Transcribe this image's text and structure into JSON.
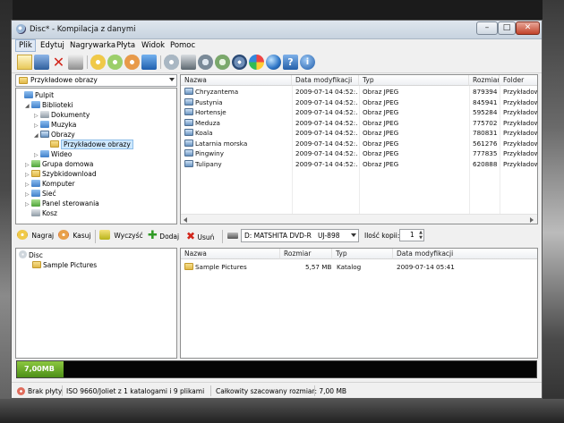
{
  "window": {
    "title": "Disc* - Kompilacja z danymi"
  },
  "title_buttons": {
    "minimize": "–",
    "maximize": "□",
    "close": "✕"
  },
  "menu": [
    "Plik",
    "Edytuj",
    "Nagrywarka",
    "Płyta",
    "Widok",
    "Pomoc"
  ],
  "toolbar_icons": [
    "new-document-icon",
    "save-icon",
    "delete-icon",
    "print-icon",
    "add-files-icon",
    "add-folder-icon",
    "disc-icon",
    "burn-icon",
    "copy-disc-icon",
    "erase-icon",
    "audio-icon",
    "settings-icon",
    "media-icon",
    "globe-icon",
    "help-icon",
    "info-icon"
  ],
  "folder_tree": {
    "combo_value": "Przykładowe obrazy",
    "items": [
      {
        "label": "Pulpit",
        "icon": "desktop-icon",
        "level": 0,
        "toggle": ""
      },
      {
        "label": "Biblioteki",
        "icon": "libraries-icon",
        "level": 1,
        "toggle": "◢"
      },
      {
        "label": "Dokumenty",
        "icon": "documents-icon",
        "level": 2,
        "toggle": "▷"
      },
      {
        "label": "Muzyka",
        "icon": "music-icon",
        "level": 2,
        "toggle": "▷"
      },
      {
        "label": "Obrazy",
        "icon": "pictures-icon",
        "level": 2,
        "toggle": "◢"
      },
      {
        "label": "Przykładowe obrazy",
        "icon": "folder-icon",
        "level": 3,
        "toggle": "",
        "selected": true
      },
      {
        "label": "Wideo",
        "icon": "video-icon",
        "level": 2,
        "toggle": "▷"
      },
      {
        "label": "Grupa domowa",
        "icon": "homegroup-icon",
        "level": 1,
        "toggle": "▷"
      },
      {
        "label": "Szybkidownload",
        "icon": "user-folder-icon",
        "level": 1,
        "toggle": "▷"
      },
      {
        "label": "Komputer",
        "icon": "computer-icon",
        "level": 1,
        "toggle": "▷"
      },
      {
        "label": "Sieć",
        "icon": "network-icon",
        "level": 1,
        "toggle": "▷"
      },
      {
        "label": "Panel sterowania",
        "icon": "control-panel-icon",
        "level": 1,
        "toggle": "▷"
      },
      {
        "label": "Kosz",
        "icon": "recycle-bin-icon",
        "level": 1,
        "toggle": ""
      }
    ]
  },
  "file_list": {
    "columns": [
      "Nazwa",
      "Data modyfikacji",
      "Typ",
      "Rozmiar",
      "Folder"
    ],
    "rows": [
      {
        "name": "Chryzantema",
        "date": "2009-07-14 04:52:...",
        "type": "Obraz JPEG",
        "size": "879394",
        "folder": "Przykładowe"
      },
      {
        "name": "Pustynia",
        "date": "2009-07-14 04:52:...",
        "type": "Obraz JPEG",
        "size": "845941",
        "folder": "Przykładowe"
      },
      {
        "name": "Hortensje",
        "date": "2009-07-14 04:52:...",
        "type": "Obraz JPEG",
        "size": "595284",
        "folder": "Przykładowe"
      },
      {
        "name": "Meduza",
        "date": "2009-07-14 04:52:...",
        "type": "Obraz JPEG",
        "size": "775702",
        "folder": "Przykładowe"
      },
      {
        "name": "Koala",
        "date": "2009-07-14 04:52:...",
        "type": "Obraz JPEG",
        "size": "780831",
        "folder": "Przykładowe"
      },
      {
        "name": "Latarnia morska",
        "date": "2009-07-14 04:52:...",
        "type": "Obraz JPEG",
        "size": "561276",
        "folder": "Przykładowe"
      },
      {
        "name": "Pingwiny",
        "date": "2009-07-14 04:52:...",
        "type": "Obraz JPEG",
        "size": "777835",
        "folder": "Przykładowe"
      },
      {
        "name": "Tulipany",
        "date": "2009-07-14 04:52:...",
        "type": "Obraz JPEG",
        "size": "620888",
        "folder": "Przykładowe"
      }
    ]
  },
  "actions": {
    "burn": "Nagraj",
    "erase": "Kasuj",
    "clear": "Wyczyść",
    "add": "Dodaj",
    "remove": "Usuń",
    "drive": "D: MATSHITA DVD-R   UJ-898",
    "copies_label": "Ilość kopii:",
    "copies_value": "1"
  },
  "disc_tree": {
    "root": "Disc",
    "child": "Sample Pictures"
  },
  "disc_contents": {
    "columns": [
      "Nazwa",
      "Rozmiar",
      "Typ",
      "Data modyfikacji"
    ],
    "rows": [
      {
        "name": "Sample Pictures",
        "size": "5,57 MB",
        "type": "Katalog",
        "date": "2009-07-14 05:41"
      }
    ]
  },
  "capacity": {
    "label": "7,00MB",
    "fill_percent": 9
  },
  "status": {
    "disc": "Brak płyty",
    "fs": "ISO 9660/Joliet z 1 katalogami i 9 plikami",
    "total": "Całkowity szacowany rozmiar: 7,00 MB"
  },
  "colors": {
    "accent": "#4d8f17",
    "selection": "#cde8ff",
    "title_bar": "#c7d3df"
  }
}
